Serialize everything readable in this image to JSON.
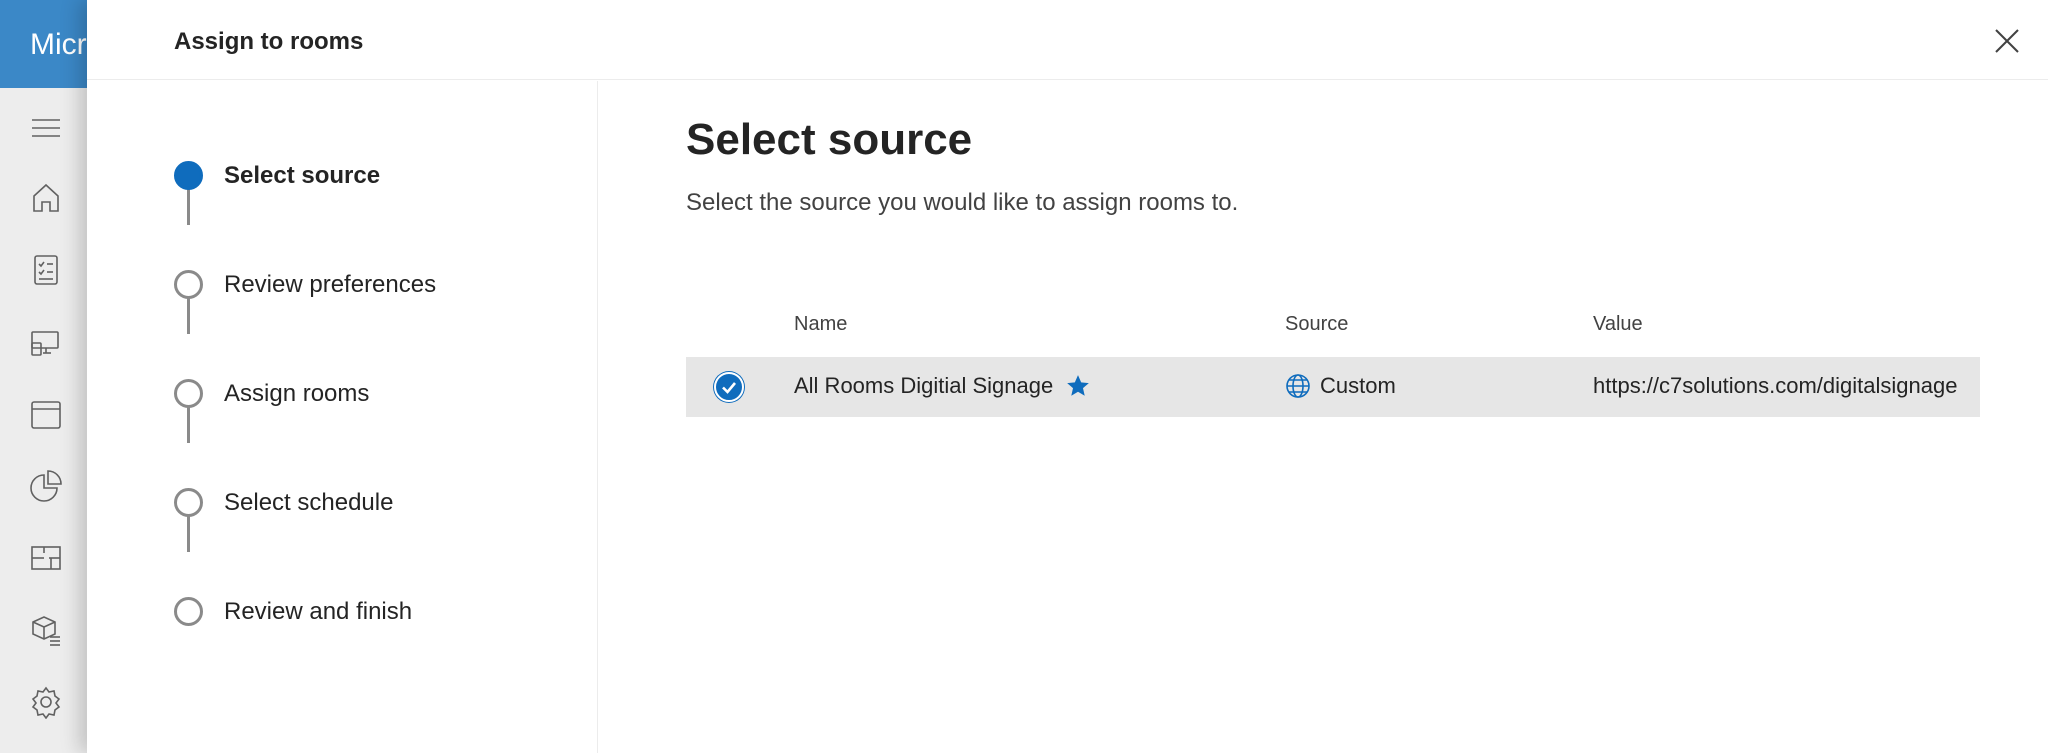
{
  "app": {
    "brand_text": "Micr"
  },
  "rail": {
    "icons": [
      "menu-icon",
      "home-icon",
      "checklist-icon",
      "devices-icon",
      "calendar-icon",
      "pie-chart-icon",
      "floor-plan-icon",
      "package-icon",
      "settings-icon"
    ]
  },
  "panel": {
    "title": "Assign to rooms",
    "close_label": "Close"
  },
  "steps": [
    {
      "label": "Select source",
      "active": true
    },
    {
      "label": "Review preferences",
      "active": false
    },
    {
      "label": "Assign rooms",
      "active": false
    },
    {
      "label": "Select schedule",
      "active": false
    },
    {
      "label": "Review and finish",
      "active": false
    }
  ],
  "content": {
    "title": "Select source",
    "description": "Select the source you would like to assign rooms to.",
    "table": {
      "columns": [
        "Name",
        "Source",
        "Value"
      ],
      "rows": [
        {
          "selected": true,
          "name": "All Rooms Digitial Signage",
          "favorite": true,
          "source": "Custom",
          "source_icon": "globe-icon",
          "value": "https://c7solutions.com/digitalsignage"
        }
      ]
    }
  },
  "colors": {
    "accent": "#0f6cbd",
    "brand": "#3b88c7",
    "selected_row": "#e6e6e6"
  }
}
